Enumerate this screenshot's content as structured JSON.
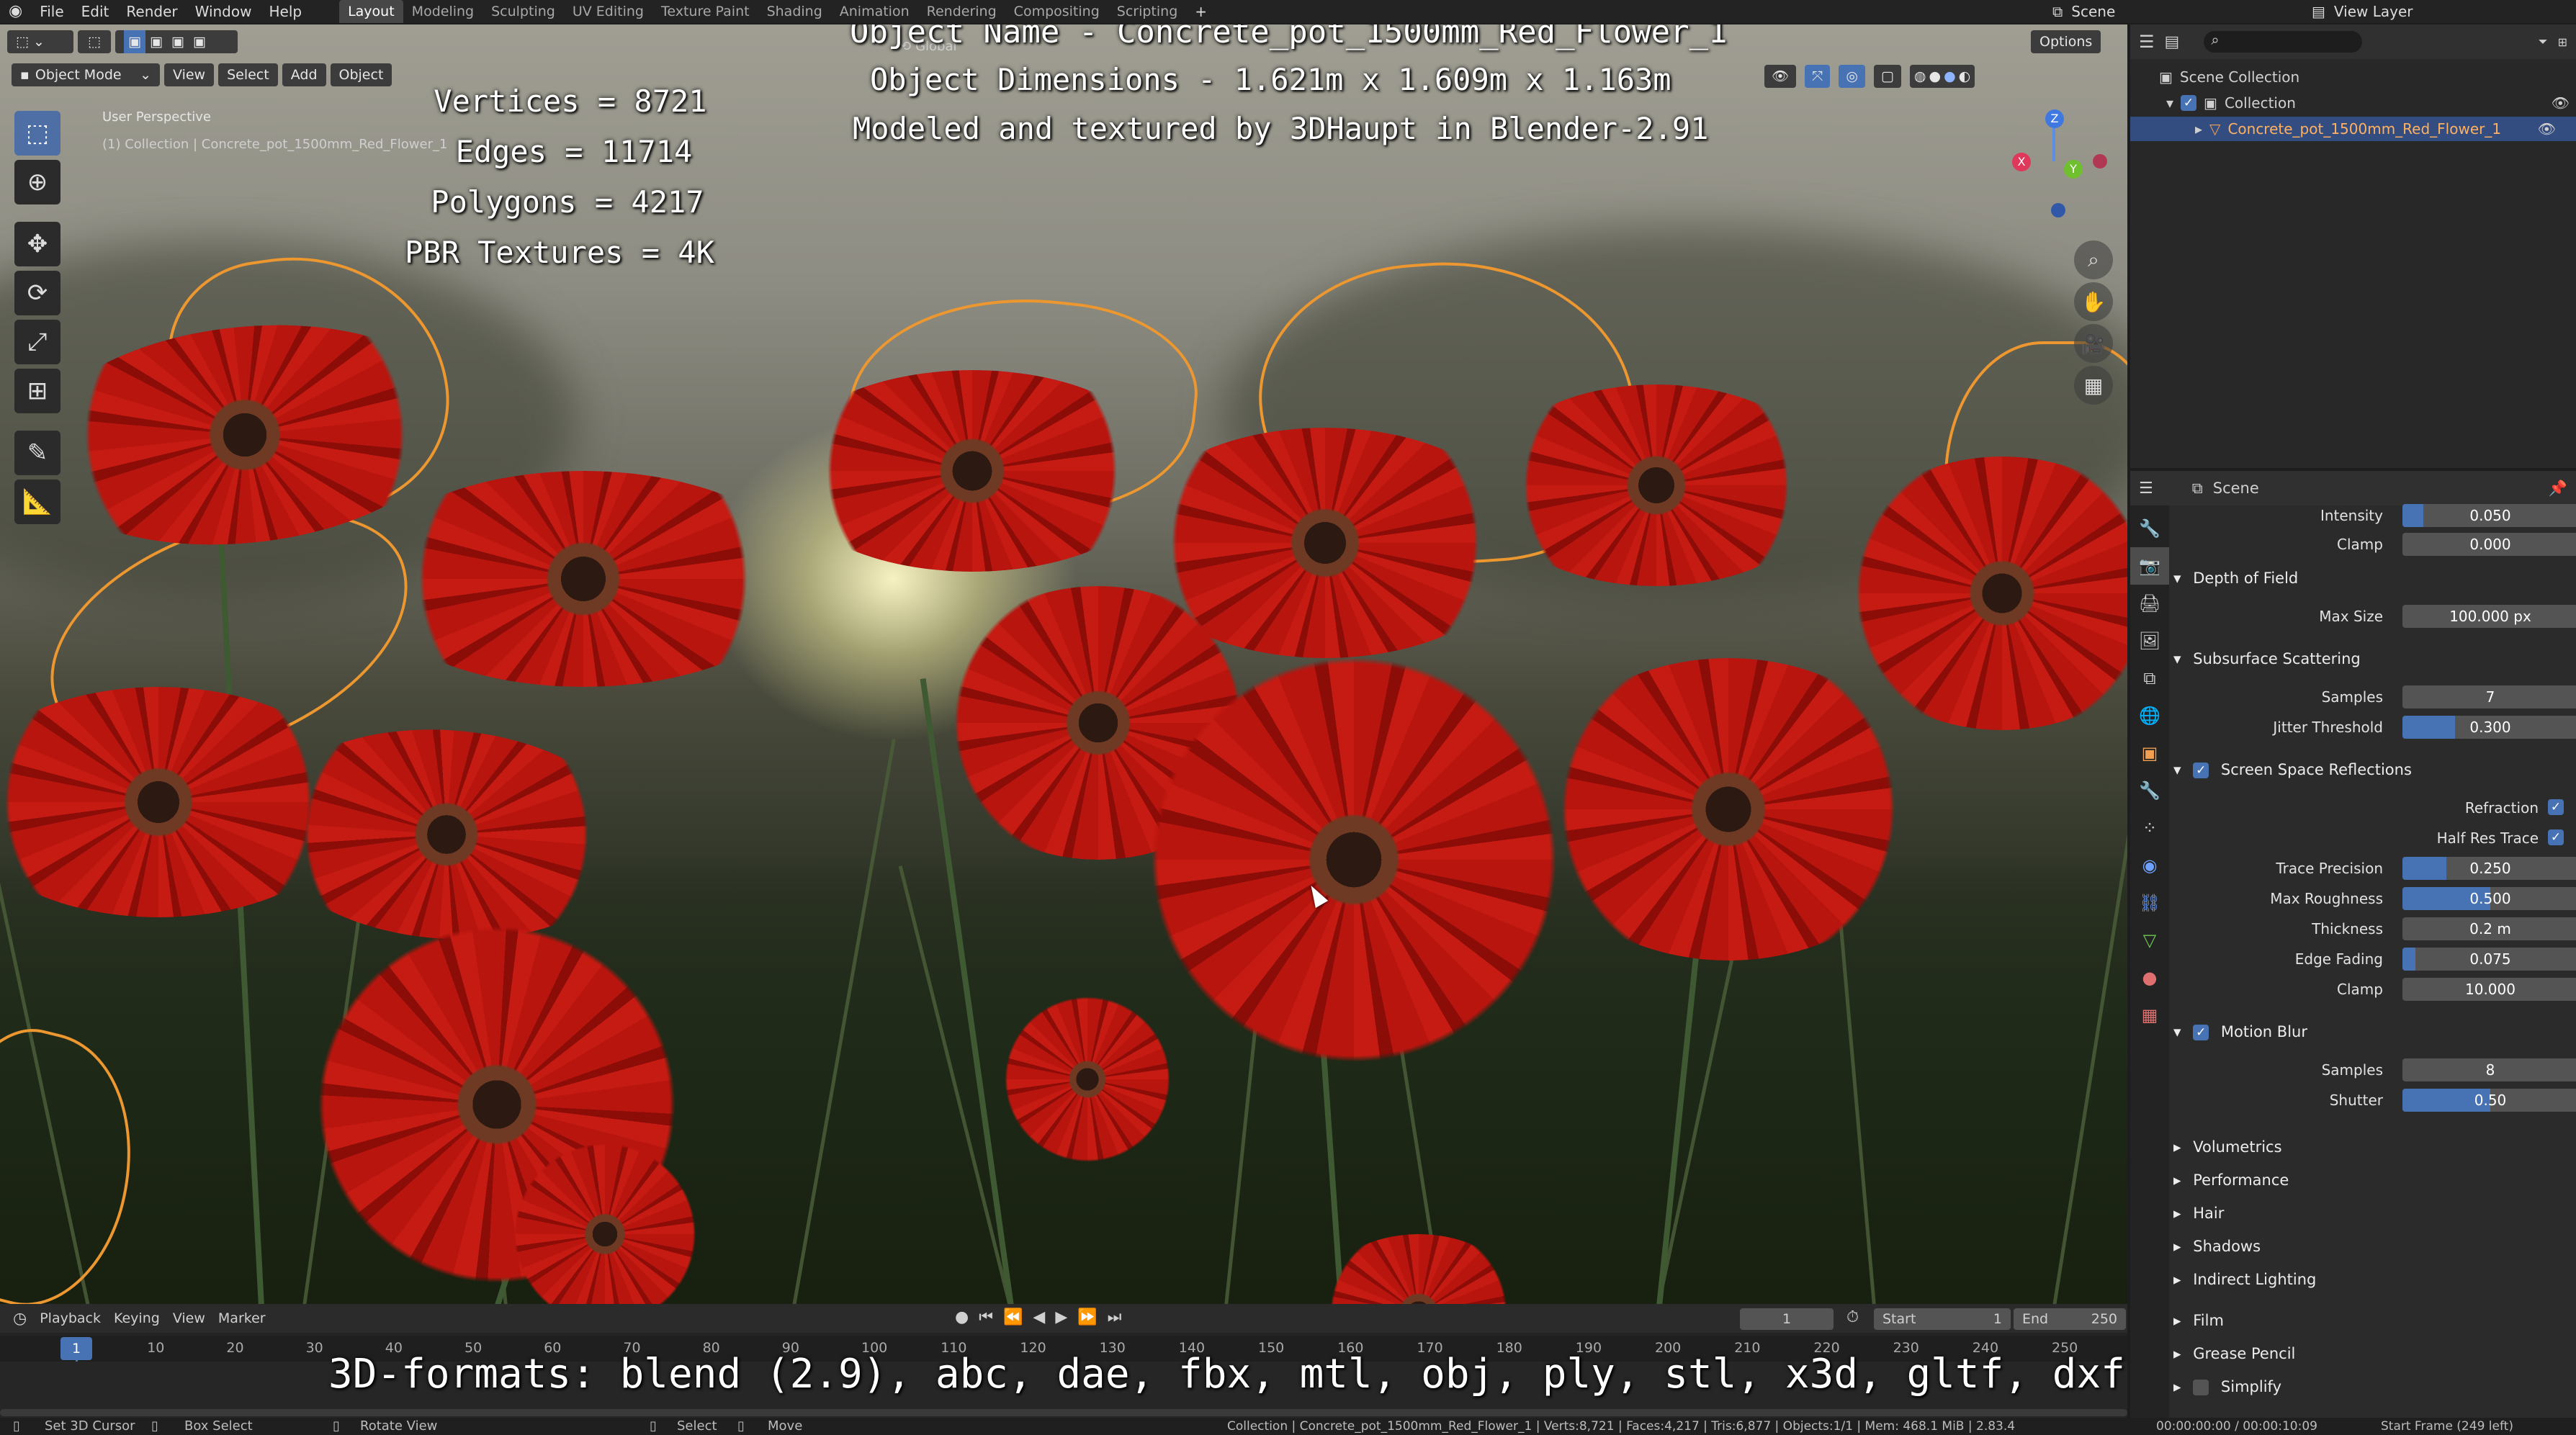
{
  "topbar": {
    "menus": [
      "File",
      "Edit",
      "Render",
      "Window",
      "Help"
    ],
    "workspaces": [
      "Layout",
      "Modeling",
      "Sculpting",
      "UV Editing",
      "Texture Paint",
      "Shading",
      "Animation",
      "Rendering",
      "Compositing",
      "Scripting"
    ],
    "active_workspace": "Layout",
    "scene_label": "Scene",
    "view_layer_label": "View Layer"
  },
  "viewport": {
    "mode_label": "Object Mode",
    "header_menus": [
      "View",
      "Select",
      "Add",
      "Object"
    ],
    "orientation_label": "Global",
    "options_label": "Options",
    "perspective_label": "User Perspective",
    "collection_label": "(1) Collection | Concrete_pot_1500mm_Red_Flower_1"
  },
  "overlay": {
    "stats": [
      "Vertices = 8721",
      "Edges = 11714",
      "Polygons = 4217",
      "PBR Textures = 4K"
    ],
    "object_name": "Object Name - Concrete_pot_1500mm_Red_Flower_1",
    "object_dimensions": "Object Dimensions -  1.621m x 1.609m x 1.163m",
    "credit": "Modeled and textured by 3DHaupt in Blender-2.91",
    "formats": "3D-formats: blend (2.9), abc, dae, fbx, mtl, obj, ply, stl, x3d, gltf, dxf"
  },
  "outliner": {
    "scene_collection": "Scene Collection",
    "collection": "Collection",
    "object": "Concrete_pot_1500mm_Red_Flower_1"
  },
  "properties": {
    "context_label": "Scene",
    "rows": {
      "intensity": {
        "label": "Intensity",
        "value": "0.050",
        "fill": 0.12
      },
      "clamp_bloom": {
        "label": "Clamp",
        "value": "0.000",
        "fill": 0
      },
      "max_size": {
        "label": "Max Size",
        "value": "100.000 px",
        "fill": 0
      },
      "sss_samples": {
        "label": "Samples",
        "value": "7",
        "fill": 0
      },
      "jitter": {
        "label": "Jitter Threshold",
        "value": "0.300",
        "fill": 0.3
      },
      "trace_precision": {
        "label": "Trace Precision",
        "value": "0.250",
        "fill": 0.25
      },
      "max_roughness": {
        "label": "Max Roughness",
        "value": "0.500",
        "fill": 0.5
      },
      "thickness": {
        "label": "Thickness",
        "value": "0.2 m",
        "fill": 0
      },
      "edge_fading": {
        "label": "Edge Fading",
        "value": "0.075",
        "fill": 0.075
      },
      "clamp_ssr": {
        "label": "Clamp",
        "value": "10.000",
        "fill": 0
      },
      "mb_samples": {
        "label": "Samples",
        "value": "8",
        "fill": 0
      },
      "shutter": {
        "label": "Shutter",
        "value": "0.50",
        "fill": 0.5
      }
    },
    "sections": {
      "dof": "Depth of Field",
      "sss": "Subsurface Scattering",
      "ssr": "Screen Space Reflections",
      "refraction": "Refraction",
      "half_res": "Half Res Trace",
      "motion_blur": "Motion Blur",
      "volumetrics": "Volumetrics",
      "performance": "Performance",
      "hair": "Hair",
      "shadows": "Shadows",
      "indirect": "Indirect Lighting",
      "film": "Film",
      "grease_pencil": "Grease Pencil",
      "simplify": "Simplify"
    }
  },
  "timeline": {
    "menus": [
      "Playback",
      "Keying",
      "View",
      "Marker"
    ],
    "current_frame": "1",
    "start_label": "Start",
    "start_value": "1",
    "end_label": "End",
    "end_value": "250",
    "ruler": [
      "1",
      "10",
      "20",
      "30",
      "40",
      "50",
      "60",
      "70",
      "80",
      "90",
      "100",
      "110",
      "120",
      "130",
      "140",
      "150",
      "160",
      "170",
      "180",
      "190",
      "200",
      "210",
      "220",
      "230",
      "240",
      "250"
    ]
  },
  "status": {
    "set_cursor": "Set 3D Cursor",
    "box_select": "Box Select",
    "rotate_view": "Rotate View",
    "select": "Select",
    "move": "Move",
    "info": "Collection | Concrete_pot_1500mm_Red_Flower_1 | Verts:8,721 | Faces:4,217 | Tris:6,877 | Objects:1/1 | Mem: 468.1 MiB | 2.83.4",
    "time": "00:00:00:00 / 00:00:10:09",
    "frame_info": "Start Frame (249 left)"
  }
}
